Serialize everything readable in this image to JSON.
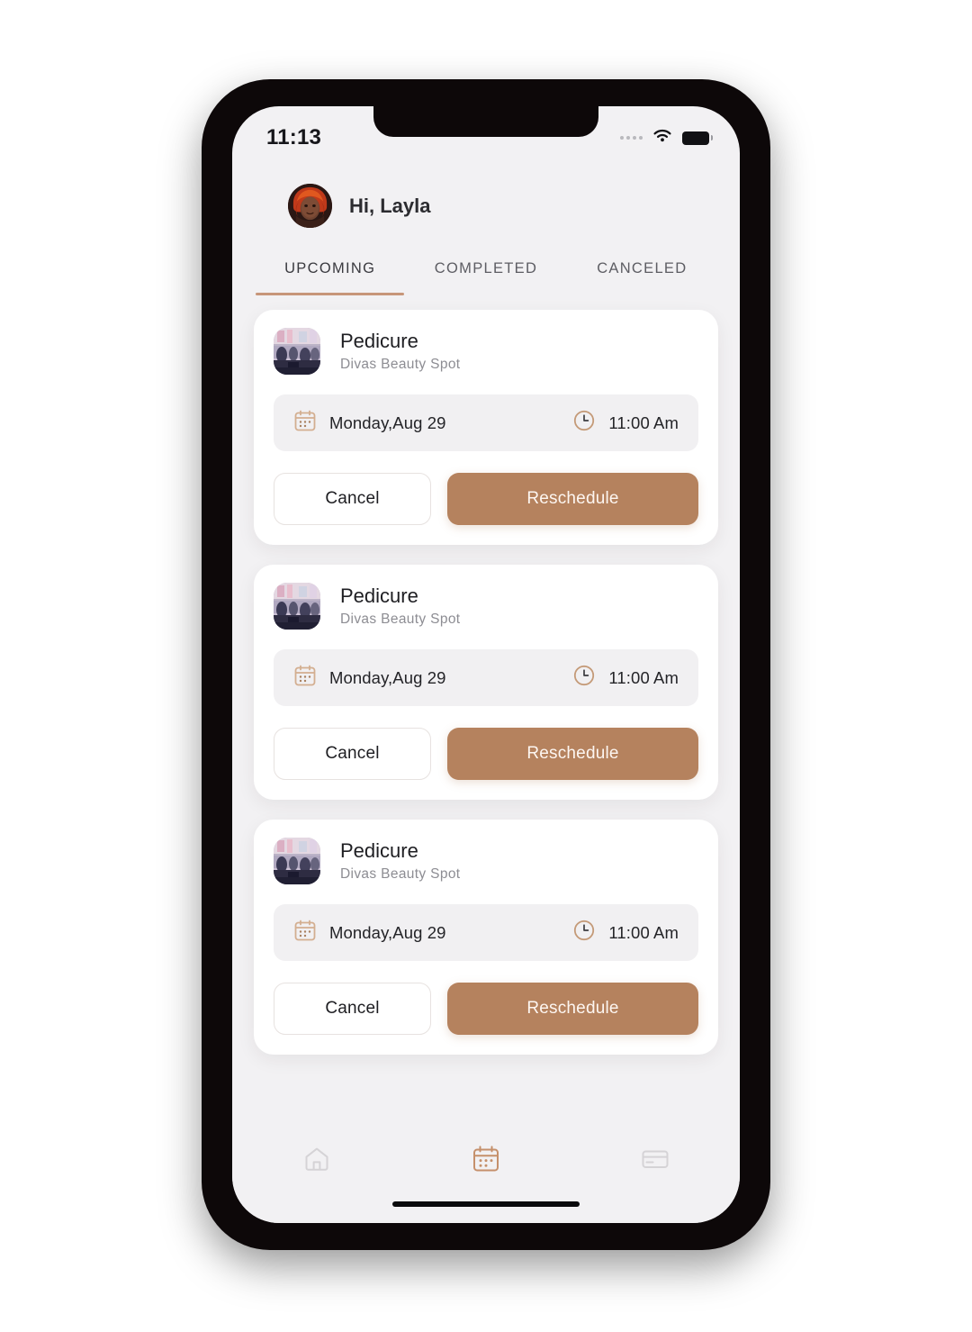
{
  "statusbar": {
    "time": "11:13",
    "signal_icon": "signal-dots-icon",
    "wifi_icon": "wifi-icon",
    "battery_icon": "battery-icon"
  },
  "header": {
    "greeting": "Hi, Layla",
    "avatar_name": "layla-avatar"
  },
  "tabs": {
    "active_index": 0,
    "items": [
      {
        "label": "UPCOMING"
      },
      {
        "label": "COMPLETED"
      },
      {
        "label": "CANCELED"
      }
    ]
  },
  "appointments": [
    {
      "service": "Pedicure",
      "salon": "Divas Beauty Spot",
      "date": "Monday,Aug 29",
      "time": "11:00 Am",
      "cancel_label": "Cancel",
      "reschedule_label": "Reschedule"
    },
    {
      "service": "Pedicure",
      "salon": "Divas Beauty Spot",
      "date": "Monday,Aug 29",
      "time": "11:00 Am",
      "cancel_label": "Cancel",
      "reschedule_label": "Reschedule"
    },
    {
      "service": "Pedicure",
      "salon": "Divas Beauty Spot",
      "date": "Monday,Aug 29",
      "time": "11:00 Am",
      "cancel_label": "Cancel",
      "reschedule_label": "Reschedule"
    }
  ],
  "bottomnav": {
    "active_index": 1,
    "items": [
      {
        "icon": "home-icon"
      },
      {
        "icon": "calendar-icon"
      },
      {
        "icon": "card-icon"
      }
    ]
  },
  "colors": {
    "accent": "#b5825e",
    "accent_light": "#c79679",
    "screen_bg": "#f2f1f3",
    "card_bg": "#ffffff",
    "pill_bg": "#f1f0f2",
    "text_primary": "#1e1e22",
    "text_muted": "#8d8d93",
    "nav_inactive": "#d5d3d6"
  }
}
